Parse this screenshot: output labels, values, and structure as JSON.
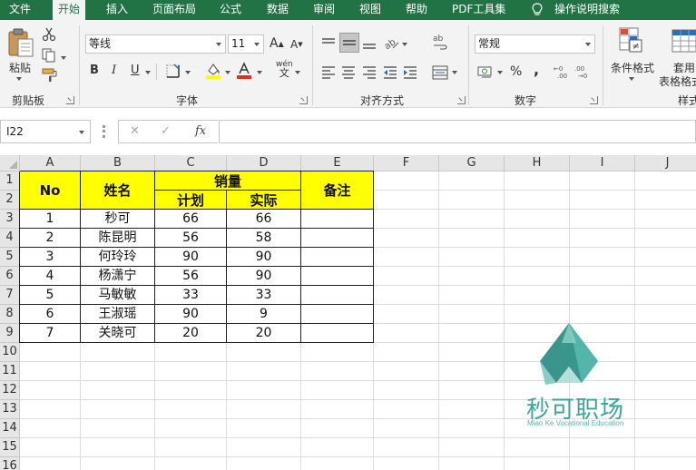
{
  "menu": {
    "items": [
      "文件",
      "开始",
      "插入",
      "页面布局",
      "公式",
      "数据",
      "审阅",
      "视图",
      "帮助",
      "PDF工具集"
    ],
    "active": "开始",
    "tell_me": "操作说明搜索"
  },
  "ribbon": {
    "clipboard": {
      "paste_label": "粘贴",
      "group_label": "剪贴板"
    },
    "font": {
      "font_name": "等线",
      "font_size": "11",
      "grow_label": "A",
      "shrink_label": "A",
      "bold": "B",
      "italic": "I",
      "underline": "U",
      "phonetic": "wén",
      "group_label": "字体"
    },
    "alignment": {
      "group_label": "对齐方式"
    },
    "number": {
      "format": "常规",
      "percent": "%",
      "comma": ",",
      "group_label": "数字"
    },
    "styles": {
      "conditional_format": "条件格式",
      "table_format_line1": "套用",
      "table_format_line2": "表格格式",
      "group_label": "样式"
    }
  },
  "formula_bar": {
    "name_box": "I22",
    "cancel": "✕",
    "enter": "✓",
    "fx": "fx",
    "formula": ""
  },
  "grid": {
    "columns": [
      "A",
      "B",
      "C",
      "D",
      "E",
      "F",
      "G",
      "H",
      "I",
      "J"
    ],
    "rows": [
      "1",
      "2",
      "3",
      "4",
      "5",
      "6",
      "7",
      "8",
      "9",
      "10",
      "11",
      "12",
      "13",
      "14",
      "15",
      "16"
    ]
  },
  "table": {
    "header": {
      "no": "No",
      "name": "姓名",
      "sales": "销量",
      "plan": "计划",
      "actual": "实际",
      "note": "备注"
    },
    "rows": [
      {
        "no": "1",
        "name": "秒可",
        "plan": "66",
        "actual": "66",
        "note": ""
      },
      {
        "no": "2",
        "name": "陈昆明",
        "plan": "56",
        "actual": "58",
        "note": ""
      },
      {
        "no": "3",
        "name": "何玲玲",
        "plan": "90",
        "actual": "90",
        "note": ""
      },
      {
        "no": "4",
        "name": "杨潇宁",
        "plan": "56",
        "actual": "90",
        "note": ""
      },
      {
        "no": "5",
        "name": "马敏敏",
        "plan": "33",
        "actual": "33",
        "note": ""
      },
      {
        "no": "6",
        "name": "王淑瑶",
        "plan": "90",
        "actual": "9",
        "note": ""
      },
      {
        "no": "7",
        "name": "关晓可",
        "plan": "20",
        "actual": "20",
        "note": ""
      }
    ],
    "header_color": "#ffff00"
  },
  "watermark": {
    "title": "秒可职场",
    "subtitle": "Miao Ke Vocational Education",
    "color": "#3aa59a"
  },
  "colors": {
    "menu_bg": "#217346",
    "ribbon_bg": "#f3f3f3"
  }
}
